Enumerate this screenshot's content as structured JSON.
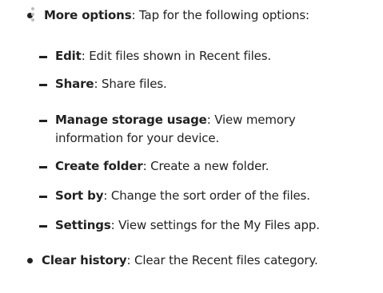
{
  "items": [
    {
      "icon": "more-options-icon",
      "term": "More options",
      "desc": ": Tap for the following options:",
      "subitems": [
        {
          "term": "Edit",
          "desc": ": Edit files shown in Recent files."
        },
        {
          "term": "Share",
          "desc": ": Share files."
        },
        {
          "term": "Manage storage usage",
          "desc": ": View memory",
          "desc_cont": "information for your device."
        },
        {
          "term": "Create folder",
          "desc": ": Create a new folder."
        },
        {
          "term": "Sort by",
          "desc": ": Change the sort order of the files."
        },
        {
          "term": "Settings",
          "desc": ": View settings for the My Files app."
        }
      ]
    },
    {
      "term": "Clear history",
      "desc": ": Clear the Recent files category."
    }
  ]
}
